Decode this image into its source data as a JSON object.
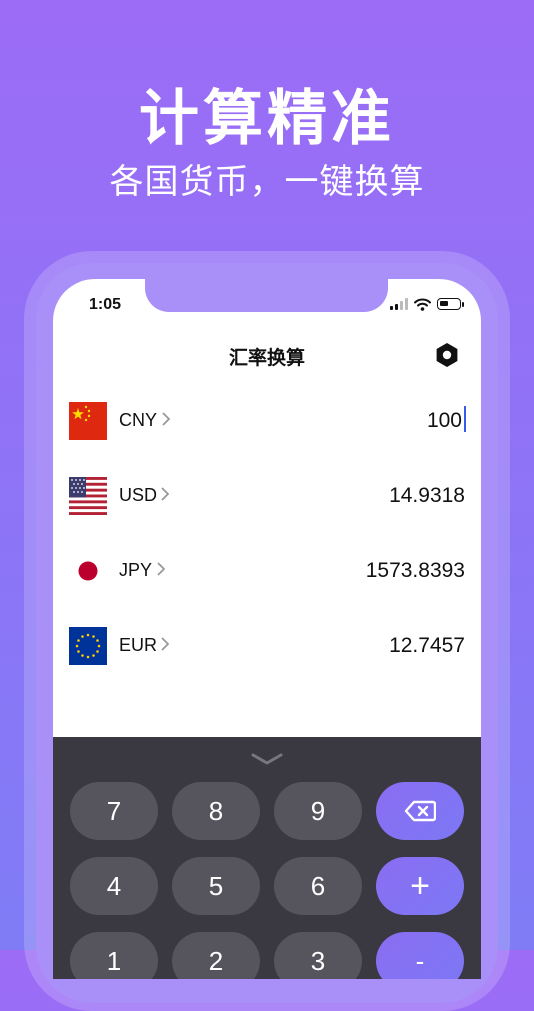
{
  "promo": {
    "headline": "计算精准",
    "subline": "各国货币，一键换算"
  },
  "status_bar": {
    "time": "1:05"
  },
  "app": {
    "title": "汇率换算",
    "settings_icon": "hexagon-settings-icon"
  },
  "currencies": [
    {
      "code": "CNY",
      "amount": "100",
      "flag": "china-flag-icon",
      "active": true
    },
    {
      "code": "USD",
      "amount": "14.9318",
      "flag": "usa-flag-icon"
    },
    {
      "code": "JPY",
      "amount": "1573.8393",
      "flag": "japan-flag-icon"
    },
    {
      "code": "EUR",
      "amount": "12.7457",
      "flag": "eu-flag-icon"
    }
  ],
  "keypad": {
    "collapse_icon": "chevron-down-icon",
    "keys": [
      "7",
      "8",
      "9",
      "⌫",
      "4",
      "5",
      "6",
      "+",
      "1",
      "2",
      "3",
      "-"
    ],
    "backspace_icon": "backspace-icon",
    "plus_label": "+"
  },
  "colors": {
    "background_top": "#9c6cf6",
    "background_bottom": "#7f7cf6",
    "keypad_bg": "#3a3941",
    "key_bg": "#56555e",
    "accent": "#8b6df2",
    "caret": "#3a59e8"
  }
}
